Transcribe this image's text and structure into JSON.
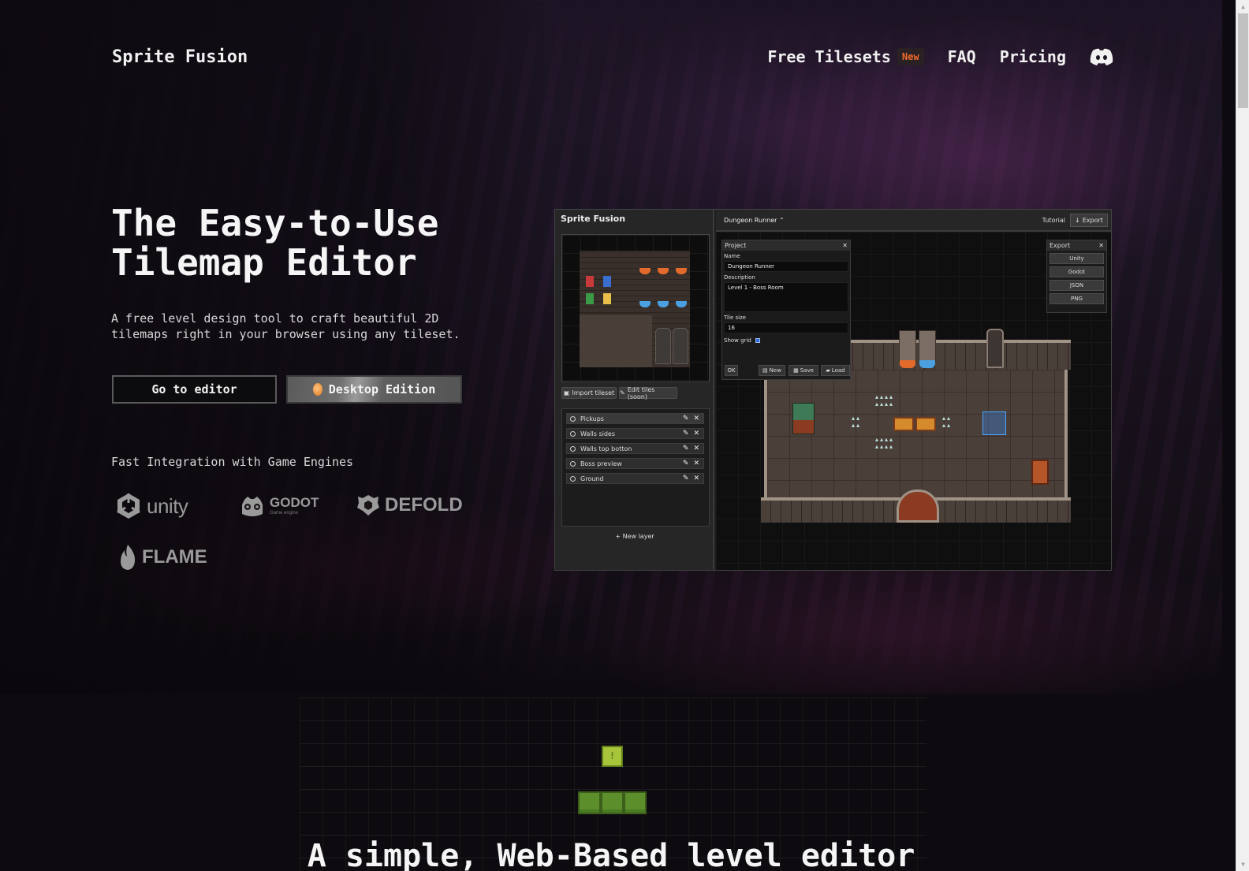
{
  "header": {
    "logo": "Sprite Fusion",
    "nav": [
      {
        "label": "Free Tilesets",
        "badge": "New"
      },
      {
        "label": "FAQ"
      },
      {
        "label": "Pricing"
      }
    ],
    "discord_icon": "discord-icon"
  },
  "hero": {
    "title_line1": "The Easy-to-Use",
    "title_line2": "Tilemap Editor",
    "subtitle": "A free level design tool to craft beautiful 2D tilemaps right in your browser using any tileset.",
    "primary_button": "Go to editor",
    "secondary_button": "Desktop Edition",
    "engines_title": "Fast Integration with Game Engines",
    "engines": [
      {
        "name": "unity"
      },
      {
        "name": "GODOT",
        "sub": "Game engine"
      },
      {
        "name": "DEFOLD"
      },
      {
        "name": "FLAME"
      }
    ]
  },
  "editor": {
    "app_title": "Sprite Fusion",
    "import_tileset": "Import tileset",
    "edit_tiles": "Edit tiles (soon)",
    "layers": [
      {
        "label": "Pickups"
      },
      {
        "label": "Walls sides"
      },
      {
        "label": "Walls top botton"
      },
      {
        "label": "Boss preview"
      },
      {
        "label": "Ground"
      }
    ],
    "new_layer": "+ New layer",
    "project_name_menu": "Dungeon Runner",
    "tutorial": "Tutorial",
    "export": "Export",
    "project_panel": {
      "title": "Project",
      "name_label": "Name",
      "name_value": "Dungeon Runner",
      "description_label": "Description",
      "description_value": "Level 1 - Boss Room",
      "tile_size_label": "Tile size",
      "tile_size_value": "16",
      "show_grid_label": "Show grid",
      "show_grid_checked": true,
      "ok": "OK",
      "new": "New",
      "save": "Save",
      "load": "Load"
    },
    "export_panel": {
      "title": "Export",
      "options": [
        "Unity",
        "Godot",
        "JSON",
        "PNG"
      ]
    }
  },
  "section2": {
    "block_symbol": "!",
    "title": "A simple, Web-Based level editor"
  },
  "colors": {
    "accent_new": "#f26b2b",
    "selection": "#4aa3ff"
  }
}
